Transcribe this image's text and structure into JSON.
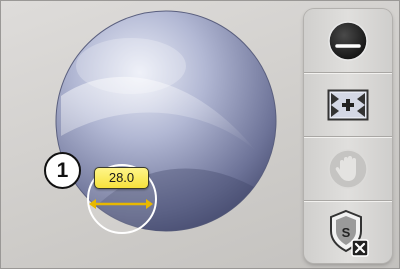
{
  "callout": {
    "number": "1"
  },
  "measurement": {
    "value": "28.0"
  },
  "toolbar": {
    "items": [
      {
        "name": "contrast",
        "icon": "half-circle-icon",
        "enabled": true
      },
      {
        "name": "zoom-fit",
        "icon": "fit-window-icon",
        "enabled": true
      },
      {
        "name": "pan",
        "icon": "hand-icon",
        "enabled": false
      },
      {
        "name": "close-shield",
        "icon": "shield-close-icon",
        "enabled": true
      }
    ]
  },
  "colors": {
    "dome_light": "#e4e7f2",
    "dome_dark": "#4a5075",
    "badge": "#f6e23c",
    "measure_line": "#e8b800"
  }
}
